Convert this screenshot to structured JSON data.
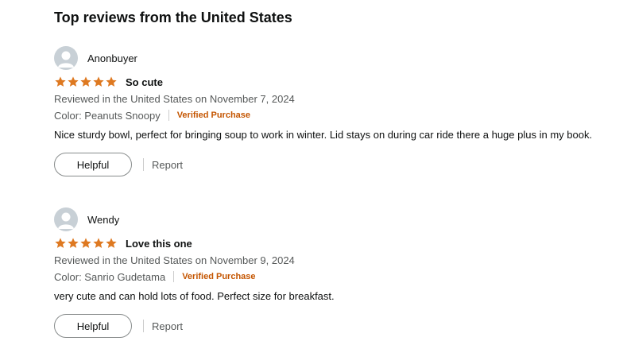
{
  "section": {
    "title": "Top reviews from the United States"
  },
  "colors": {
    "star": "#de7921",
    "verified": "#c45500",
    "avatar": "#c8d0d6"
  },
  "reviews": [
    {
      "reviewer": "Anonbuyer",
      "rating": 5,
      "title": "So cute",
      "date": "Reviewed in the United States on November 7, 2024",
      "variant": "Color: Peanuts Snoopy",
      "verified": "Verified Purchase",
      "body": "Nice sturdy bowl, perfect for bringing soup to work in winter. Lid stays on during car ride there a huge plus in my book.",
      "helpful_label": "Helpful",
      "report_label": "Report"
    },
    {
      "reviewer": "Wendy",
      "rating": 5,
      "title": "Love this one",
      "date": "Reviewed in the United States on November 9, 2024",
      "variant": "Color: Sanrio Gudetama",
      "verified": "Verified Purchase",
      "body": "very cute and can hold lots of food. Perfect size for breakfast.",
      "helpful_label": "Helpful",
      "report_label": "Report"
    }
  ]
}
